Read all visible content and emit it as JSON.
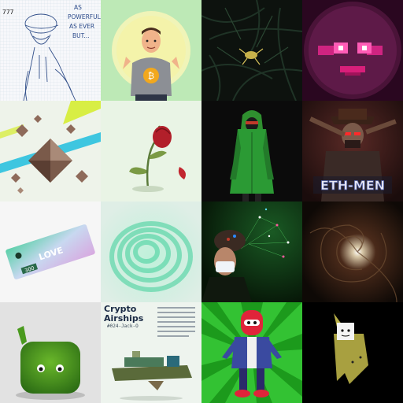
{
  "tiles": [
    {
      "name": "sketch-soldier",
      "title": "777",
      "caption_lines": [
        "AS",
        "POWERFUL",
        "AS EVER",
        "BUT..."
      ]
    },
    {
      "name": "bitcoin-man",
      "bg": "#b9ecb0"
    },
    {
      "name": "dark-foliage-creature",
      "bg": "#0d120e"
    },
    {
      "name": "pink-face-circle",
      "bg": "#3b0d2c"
    },
    {
      "name": "floating-octahedrons",
      "bg": "#eef3ea"
    },
    {
      "name": "wilted-rose",
      "bg": "#e9f4e5"
    },
    {
      "name": "green-hooded-figure",
      "bg": "#0b0b0b"
    },
    {
      "name": "eth-men-character",
      "logo_text": "ETH-MEN"
    },
    {
      "name": "love-ticket",
      "ticket_text": "LOVE",
      "ticket_number": "300"
    },
    {
      "name": "teal-ripple",
      "bg": "#d8ece2"
    },
    {
      "name": "masked-woman-network",
      "bg": "#0d2a10"
    },
    {
      "name": "dark-tunnel",
      "bg": "#120d0a"
    },
    {
      "name": "green-fuzzy-block",
      "bg": "#dcdcdc"
    },
    {
      "name": "crypto-airships",
      "title_line1": "Crypto",
      "title_line2": "Airships",
      "subtitle": "#024-Jack-O"
    },
    {
      "name": "red-robot-character",
      "bg": "#2bbf2b"
    },
    {
      "name": "cube-ghost",
      "bg": "#000000"
    }
  ]
}
